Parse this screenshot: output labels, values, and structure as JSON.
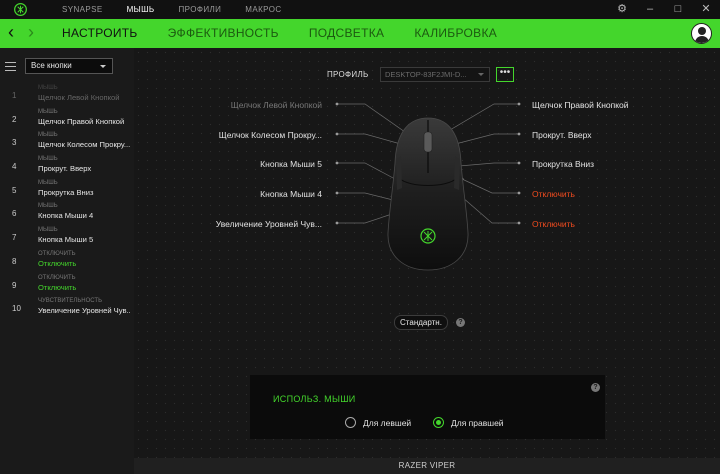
{
  "titlebar": {
    "nav": [
      "SYNAPSE",
      "МЫШЬ",
      "ПРОФИЛИ",
      "МАКРОС"
    ],
    "active_nav": 1,
    "controls": {
      "settings": "⚙",
      "minimize": "–",
      "maximize": "□",
      "close": "✕"
    }
  },
  "tabbar": {
    "tabs": [
      "НАСТРОИТЬ",
      "ЭФФЕКТИВНОСТЬ",
      "ПОДСВЕТКА",
      "КАЛИБРОВКА"
    ],
    "active_tab": 0,
    "back": "‹",
    "forward": "›"
  },
  "sidebar": {
    "filter": "Все кнопки",
    "items": [
      {
        "num": "1",
        "cat": "МЫШЬ",
        "val": "Щелчок Левой Кнопкой",
        "dim": true
      },
      {
        "num": "2",
        "cat": "МЫШЬ",
        "val": "Щелчок Правой Кнопкой"
      },
      {
        "num": "3",
        "cat": "МЫШЬ",
        "val": "Щелчок Колесом Прокру..."
      },
      {
        "num": "4",
        "cat": "МЫШЬ",
        "val": "Прокрут. Вверх"
      },
      {
        "num": "5",
        "cat": "МЫШЬ",
        "val": "Прокрутка Вниз"
      },
      {
        "num": "6",
        "cat": "МЫШЬ",
        "val": "Кнопка Мыши 4"
      },
      {
        "num": "7",
        "cat": "МЫШЬ",
        "val": "Кнопка Мыши 5"
      },
      {
        "num": "8",
        "cat": "ОТКЛЮЧИТЬ",
        "val": "Отключить",
        "green": true
      },
      {
        "num": "9",
        "cat": "ОТКЛЮЧИТЬ",
        "val": "Отключить",
        "green": true
      },
      {
        "num": "10",
        "cat": "ЧУВСТВИТЕЛЬНОСТЬ",
        "val": "Увеличение Уровней Чув..."
      }
    ]
  },
  "profile": {
    "label": "ПРОФИЛЬ",
    "value": "DESKTOP-83F2JMI-D...",
    "more": "•••"
  },
  "mouse_map": {
    "left": [
      "Щелчок Левой Кнопкой",
      "Щелчок Колесом Прокру...",
      "Кнопка Мыши 5",
      "Кнопка Мыши 4",
      "Увеличение Уровней Чув..."
    ],
    "right": [
      "Щелчок Правой Кнопкой",
      "Прокрут. Вверх",
      "Прокрутка Вниз",
      "Отключить",
      "Отключить"
    ]
  },
  "standard_button": "Стандартн.",
  "help": "?",
  "hand": {
    "title": "ИСПОЛЬЗ. МЫШИ",
    "left": "Для левшей",
    "right": "Для правшей",
    "selected": "right"
  },
  "device": "RAZER VIPER",
  "colors": {
    "accent": "#44d62c",
    "warning": "#f04b1e",
    "background": "#171717"
  }
}
